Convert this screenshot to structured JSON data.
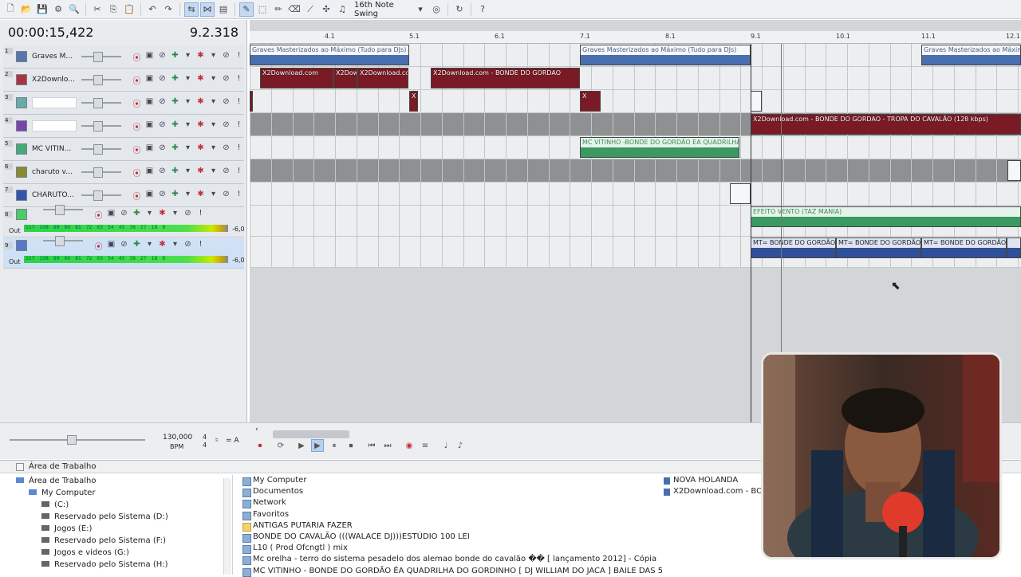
{
  "toolbar": {
    "swing_label": "16th Note Swing"
  },
  "time": {
    "position": "00:00:15,422",
    "measure": "9.2.318"
  },
  "tracks": [
    {
      "num": "1",
      "name": "Graves M...",
      "color": "#5577aa"
    },
    {
      "num": "2",
      "name": "X2Downlo...",
      "color": "#aa3344"
    },
    {
      "num": "3",
      "name": "",
      "color": "#66aaaa"
    },
    {
      "num": "4",
      "name": "",
      "color": "#7744aa"
    },
    {
      "num": "5",
      "name": "MC VITIN...",
      "color": "#44aa77"
    },
    {
      "num": "6",
      "name": "charuto v...",
      "color": "#8a8a30"
    },
    {
      "num": "7",
      "name": "CHARUTO...",
      "color": "#3355aa"
    },
    {
      "num": "8",
      "name": "",
      "color": "#4ccc66"
    },
    {
      "num": "9",
      "name": "",
      "color": "#5577cc"
    }
  ],
  "bus": {
    "out_label": "Out",
    "db_value": "-6,0",
    "meter_ticks": [
      "117",
      "108",
      "99",
      "90",
      "81",
      "72",
      "63",
      "54",
      "45",
      "36",
      "27",
      "18",
      "9"
    ]
  },
  "ruler": [
    "4.1",
    "5.1",
    "6.1",
    "7.1",
    "8.1",
    "9.1",
    "10.1",
    "11.1",
    "12.1"
  ],
  "clips": {
    "graves": "Graves Masterizados ao Máximo (Tudo para DJs)",
    "x2": "X2Download.com",
    "x2_bonde": "X2Download.com - BONDE DO GORDAO",
    "x2_tropa": "X2Download.com - BONDE DO GORDAO - TROPA DO CAVALÃO (128 kbps)",
    "mc": "MC VITINHO -BONDE DO GORDÃO EA QUADRILHA",
    "efeito": "EFEITO VENTO (TAZ MANIA)",
    "mt": "MT= BONDE DO GORDÃO",
    "x": "X"
  },
  "transport": {
    "bpm": "130,000",
    "bpm_label": "BPM",
    "sig_top": "4",
    "sig_bottom": "4",
    "key": "= A"
  },
  "explorer": {
    "title": "Área de Trabalho",
    "tree": [
      "Área de Trabalho",
      "My Computer",
      "(C:)",
      "Reservado pelo Sistema (D:)",
      "Jogos (E:)",
      "Reservado pelo Sistema (F:)",
      "Jogos e videos (G:)",
      "Reservado pelo Sistema (H:)"
    ],
    "files": [
      "My Computer",
      "Documentos",
      "Network",
      "Favoritos",
      "ANTIGAS PUTARIA FAZER",
      "BONDE DO CAVALÃO (((WALACE DJ)))ESTÚDIO 100 LEI",
      "L10 ( Prod Ofcngtl ) mix",
      "Mc orelha - terro do sistema pesadelo dos alemao bonde do cavalão �� [ lançamento 2012] - Cópia",
      "MC VITINHO - BONDE DO GORDÃO ÉA QUADRILHA DO GORDINHO [ DJ WILLIAM DO JACA ] BAILE DAS 5 BOCA ]"
    ],
    "files2": [
      "NOVA HOLANDA",
      "X2Download.com - BONDE"
    ]
  }
}
